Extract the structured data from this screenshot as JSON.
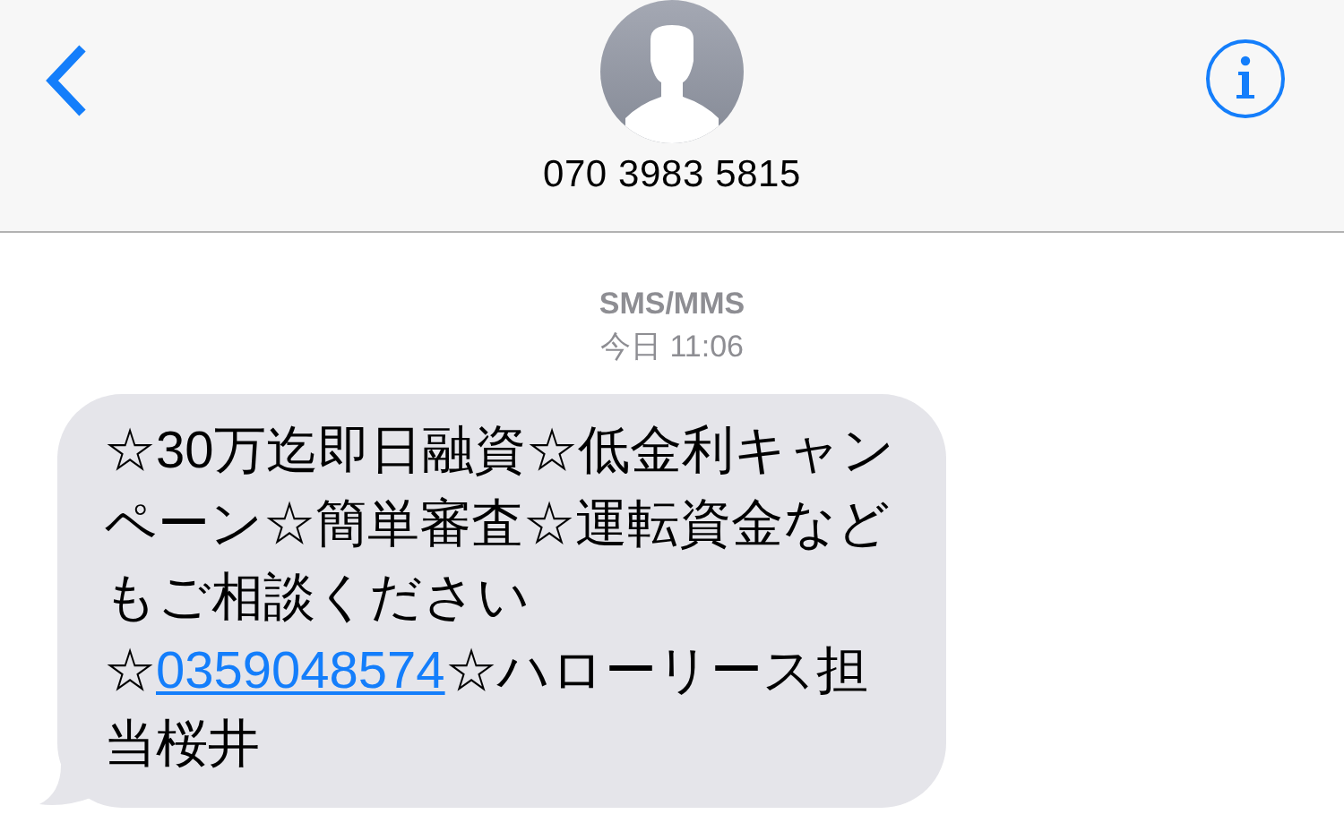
{
  "header": {
    "back": {
      "kind": "chevron"
    },
    "contact": "070 3983 5815",
    "info": {
      "kind": "info"
    }
  },
  "thread": {
    "service": "SMS/MMS",
    "timestamp": "今日 11:06"
  },
  "messages": [
    {
      "parts": [
        {
          "kind": "text",
          "text": "☆30万迄即日融資☆低金利キャンペーン☆簡単審査☆運転資金などもご相談ください"
        },
        {
          "kind": "break"
        },
        {
          "kind": "text",
          "text": "☆"
        },
        {
          "kind": "link",
          "text": "0359048574"
        },
        {
          "kind": "text",
          "text": "☆ハローリース担当桜井"
        }
      ]
    }
  ]
}
